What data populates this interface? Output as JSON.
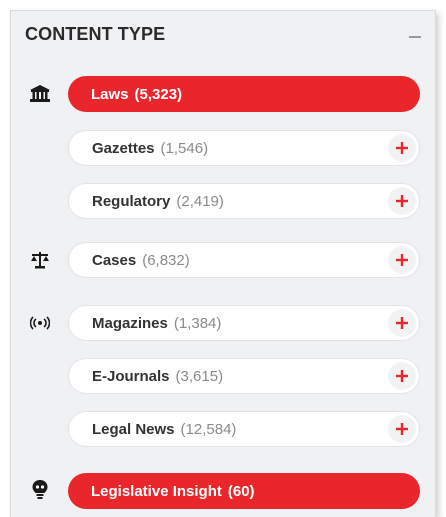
{
  "panel": {
    "title": "CONTENT TYPE",
    "collapse_icon": "minus-icon"
  },
  "colors": {
    "accent": "#e8262b",
    "panel_bg": "#f0f1f3",
    "count_gray": "#8a8a8a"
  },
  "items": [
    {
      "name": "Laws",
      "count": "(5,323)",
      "active": true,
      "group_icon": "courthouse-icon"
    },
    {
      "name": "Gazettes",
      "count": "(1,546)",
      "active": false
    },
    {
      "name": "Regulatory",
      "count": "(2,419)",
      "active": false
    },
    {
      "name": "Cases",
      "count": "(6,832)",
      "active": false,
      "group_icon": "scales-icon"
    },
    {
      "name": "Magazines",
      "count": "(1,384)",
      "active": false,
      "group_icon": "broadcast-icon"
    },
    {
      "name": "E-Journals",
      "count": "(3,615)",
      "active": false
    },
    {
      "name": "Legal News",
      "count": "(12,584)",
      "active": false
    },
    {
      "name": "Legislative Insight",
      "count": "(60)",
      "active": true,
      "group_icon": "lightbulb-icon"
    }
  ]
}
